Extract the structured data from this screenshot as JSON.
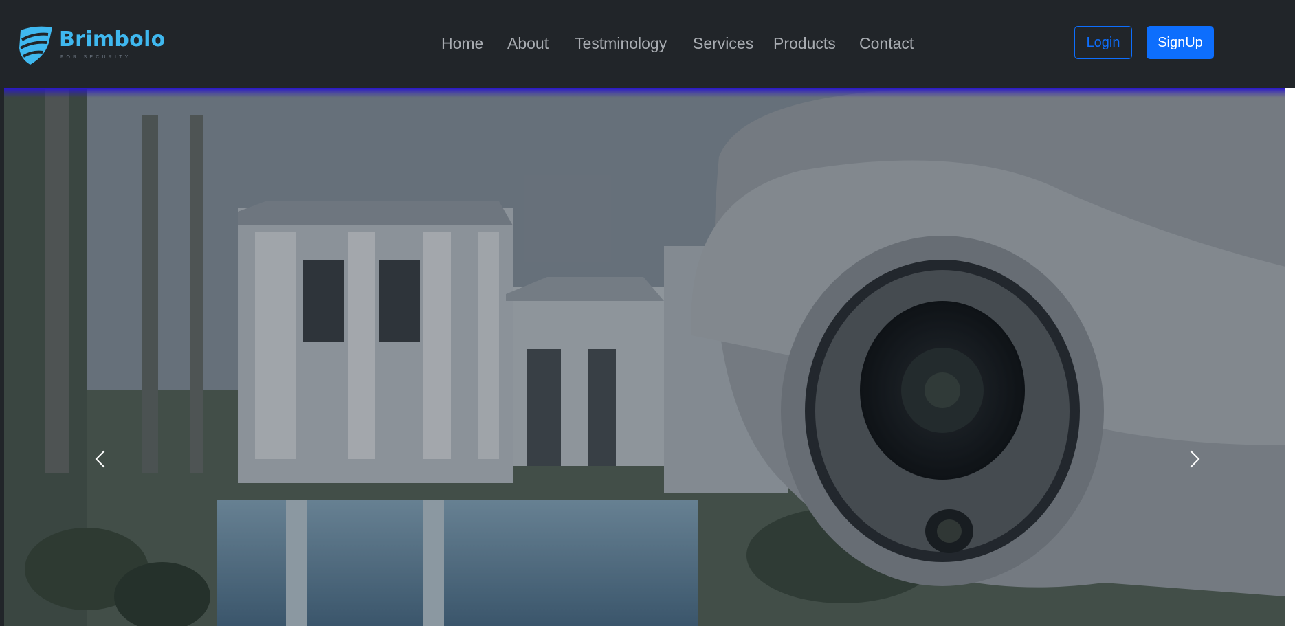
{
  "brand": {
    "name": "Brimbolo",
    "tagline": "FOR SECURITY",
    "icon": "shield-icon",
    "color": "#3fb8ef"
  },
  "nav": {
    "links": [
      {
        "label": "Home"
      },
      {
        "label": "About"
      },
      {
        "label": "Testminology"
      },
      {
        "label": "Services"
      },
      {
        "label": "Products"
      },
      {
        "label": "Contact"
      }
    ]
  },
  "auth": {
    "login_label": "Login",
    "signup_label": "SignUp",
    "accent": "#0d6efd"
  },
  "carousel": {
    "prev_icon": "chevron-left-icon",
    "next_icon": "chevron-right-icon"
  }
}
